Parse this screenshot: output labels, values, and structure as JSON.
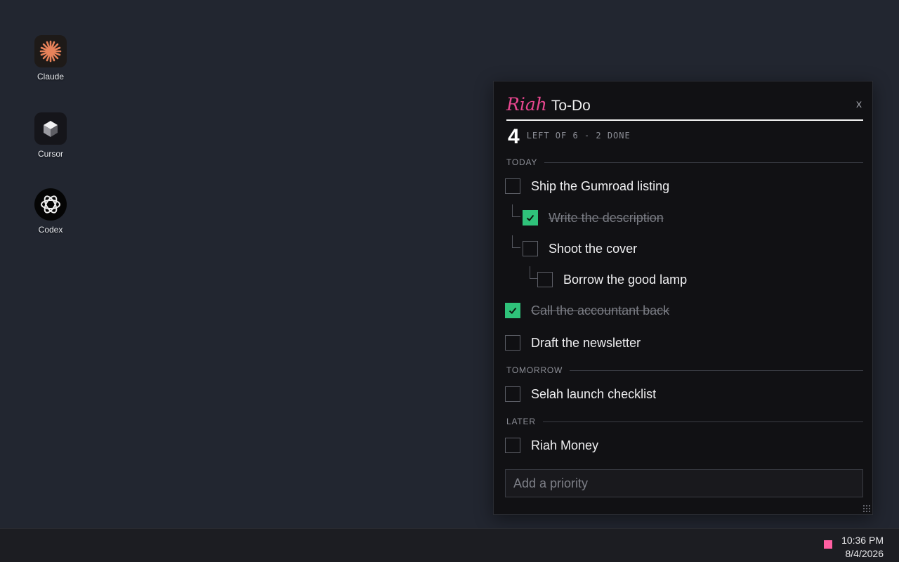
{
  "desktop": {
    "icons": [
      {
        "label": "Claude",
        "icon": "claude-starburst-icon",
        "color": "#e8825a"
      },
      {
        "label": "Cursor",
        "icon": "cursor-cube-icon",
        "color": "#d8d8dc"
      },
      {
        "label": "Codex",
        "icon": "codex-knot-icon",
        "color": "#f0f0f0"
      }
    ]
  },
  "widget": {
    "brand": "Riah",
    "title": "To-Do",
    "close_label": "x",
    "counter": {
      "remaining": "4",
      "summary": "LEFT OF 6 - 2 DONE"
    },
    "sections": {
      "today": "TODAY",
      "tomorrow": "TOMORROW",
      "later": "LATER"
    },
    "tasks": {
      "ship": {
        "text": "Ship the Gumroad listing",
        "done": false
      },
      "description": {
        "text": "Write the description",
        "done": true
      },
      "cover": {
        "text": "Shoot the cover",
        "done": false
      },
      "lamp": {
        "text": "Borrow the good lamp",
        "done": false
      },
      "accountant": {
        "text": "Call the accountant back",
        "done": true
      },
      "newsletter": {
        "text": "Draft the newsletter",
        "done": false
      },
      "selah": {
        "text": "Selah launch checklist",
        "done": false
      },
      "money": {
        "text": "Riah Money",
        "done": false
      }
    },
    "add_placeholder": "Add a priority",
    "colors": {
      "accent": "#e8478f",
      "check": "#2fc27a"
    }
  },
  "taskbar": {
    "time": "10:36 PM",
    "date": "8/4/2026",
    "tray_color": "#ff5fa2"
  }
}
